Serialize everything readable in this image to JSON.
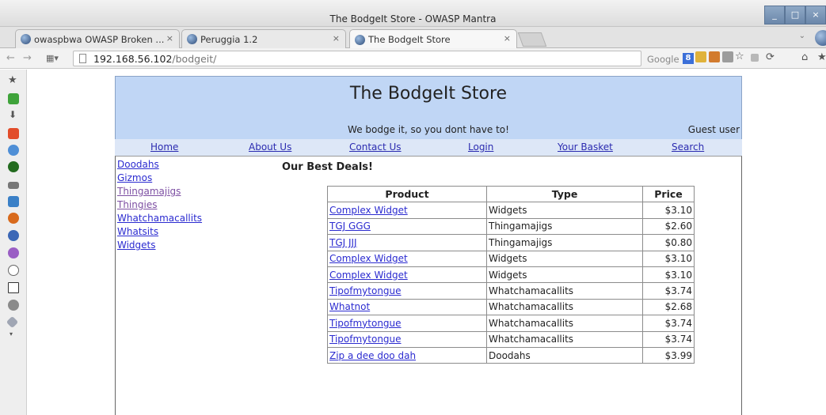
{
  "window": {
    "title": "The BodgeIt Store - OWASP Mantra"
  },
  "tabs": [
    {
      "label": "owaspbwa OWASP Broken ...",
      "close": "×"
    },
    {
      "label": "Peruggia 1.2",
      "close": "×"
    },
    {
      "label": "The BodgeIt Store",
      "close": "×"
    }
  ],
  "navbar": {
    "url_host": "192.168.56.102",
    "url_path": "/bodgeit/",
    "search_engine": "Google"
  },
  "store": {
    "title": "The BodgeIt Store",
    "tagline": "We bodge it, so you dont have to!",
    "user": "Guest user",
    "menu": [
      "Home",
      "About Us",
      "Contact Us",
      "Login",
      "Your Basket",
      "Search"
    ],
    "categories": [
      "Doodahs",
      "Gizmos",
      "Thingamajigs",
      "Thingies",
      "Whatchamacallits",
      "Whatsits",
      "Widgets"
    ],
    "deals_heading": "Our Best Deals!",
    "table_headers": [
      "Product",
      "Type",
      "Price"
    ],
    "products": [
      {
        "name": "Complex Widget",
        "type": "Widgets",
        "price": "$3.10"
      },
      {
        "name": "TGJ GGG",
        "type": "Thingamajigs",
        "price": "$2.60"
      },
      {
        "name": "TGJ JJJ",
        "type": "Thingamajigs",
        "price": "$0.80"
      },
      {
        "name": "Complex Widget",
        "type": "Widgets",
        "price": "$3.10"
      },
      {
        "name": "Complex Widget",
        "type": "Widgets",
        "price": "$3.10"
      },
      {
        "name": "Tipofmytongue",
        "type": "Whatchamacallits",
        "price": "$3.74"
      },
      {
        "name": "Whatnot",
        "type": "Whatchamacallits",
        "price": "$2.68"
      },
      {
        "name": "Tipofmytongue",
        "type": "Whatchamacallits",
        "price": "$3.74"
      },
      {
        "name": "Tipofmytongue",
        "type": "Whatchamacallits",
        "price": "$3.74"
      },
      {
        "name": "Zip a dee doo dah",
        "type": "Doodahs",
        "price": "$3.99"
      }
    ]
  }
}
